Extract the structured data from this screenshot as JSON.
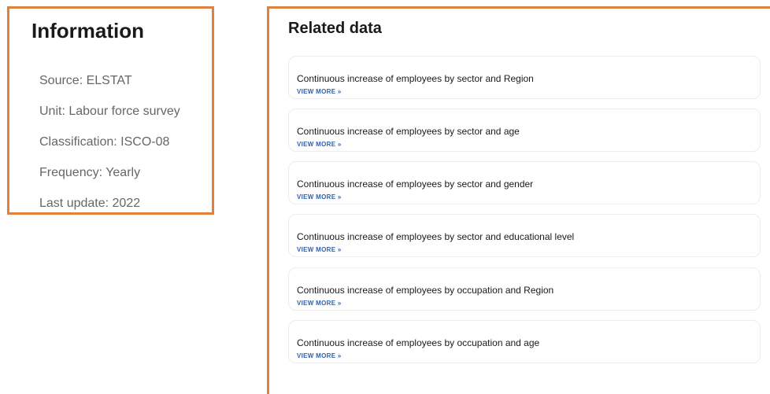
{
  "information": {
    "title": "Information",
    "items": [
      "Source: ELSTAT",
      "Unit: Labour force survey",
      "Classification: ISCO-08",
      "Frequency: Yearly",
      "Last update: 2022"
    ]
  },
  "related": {
    "title": "Related data",
    "link_label": "VIEW MORE »",
    "items": [
      "Continuous increase of employees by sector and Region",
      "Continuous increase of employees by sector and age",
      "Continuous increase of employees by sector and gender",
      "Continuous increase of employees by sector and educational level",
      "Continuous increase of employees by occupation and Region",
      "Continuous increase of employees by occupation and age"
    ]
  },
  "colors": {
    "highlight_border": "#e0813f",
    "link": "#2a62b8"
  }
}
